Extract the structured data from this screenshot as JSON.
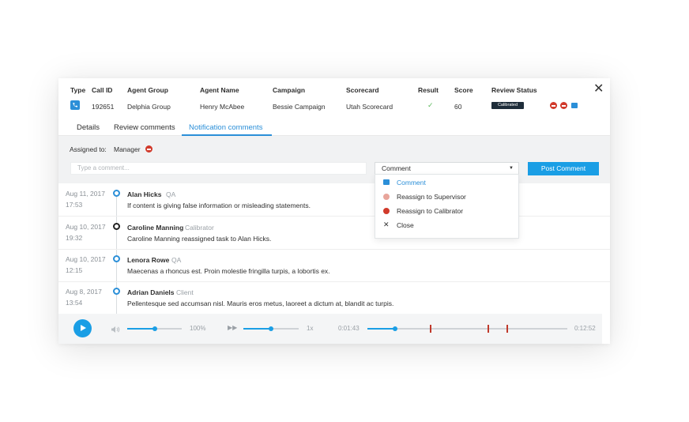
{
  "table": {
    "headers": [
      "Type",
      "Call ID",
      "Agent Group",
      "Agent Name",
      "Campaign",
      "Scorecard",
      "Result",
      "Score",
      "Review Status"
    ],
    "row": {
      "type_icon": "phone-icon",
      "call_id": "192651",
      "agent_group": "Delphia Group",
      "agent_name": "Henry McAbee",
      "campaign": "Bessie Campaign",
      "scorecard": "Utah Scorecard",
      "result_icon": "check-icon",
      "score": "60",
      "review_status": "Calibrated",
      "status_badges": [
        "supervisor-badge",
        "qa-badge",
        "comment-badge"
      ]
    }
  },
  "close_icon": "close-icon",
  "tabs": [
    {
      "label": "Details",
      "active": false
    },
    {
      "label": "Review comments",
      "active": false
    },
    {
      "label": "Notification comments",
      "active": true
    }
  ],
  "assigned": {
    "label": "Assigned to:",
    "value": "Manager"
  },
  "comment_input": {
    "placeholder": "Type a comment..."
  },
  "comment_type": {
    "selected": "Comment"
  },
  "post_button": "Post Comment",
  "dropdown_options": [
    {
      "label": "Comment",
      "icon": "comment-icon",
      "color": "#2b8fd8",
      "highlighted": true
    },
    {
      "label": "Reassign to Supervisor",
      "icon": "supervisor-icon",
      "color": "#e8a59b",
      "highlighted": false
    },
    {
      "label": "Reassign to Calibrator",
      "icon": "calibrator-icon",
      "color": "#d13a2b",
      "highlighted": false
    },
    {
      "label": "Close",
      "icon": "close-icon",
      "color": "#333333",
      "highlighted": false
    }
  ],
  "comments": [
    {
      "date": "Aug 11, 2017",
      "time": "17:53",
      "name": "Alan Hicks",
      "role": "QA",
      "text": "If content is giving false information or misleading statements.",
      "dot": "blue"
    },
    {
      "date": "Aug 10, 2017",
      "time": "19:32",
      "name": "Caroline Manning",
      "role": "Calibrator",
      "text": "Caroline Manning reassigned task to Alan Hicks.",
      "dot": "dark"
    },
    {
      "date": "Aug 10, 2017",
      "time": "12:15",
      "name": "Lenora Rowe",
      "role": "QA",
      "text": "Maecenas a rhoncus est. Proin molestie fringilla turpis, a lobortis ex.",
      "dot": "blue"
    },
    {
      "date": "Aug 8, 2017",
      "time": "13:54",
      "name": "Adrian Daniels",
      "role": "Client",
      "text": "Pellentesque sed accumsan nisl. Mauris eros metus, laoreet a dictum at, blandit ac turpis.",
      "dot": "blue"
    }
  ],
  "player": {
    "volume_label": "100%",
    "volume_level": 0.5,
    "speed_label": "1x",
    "speed_level": 0.5,
    "current_time": "0:01:43",
    "total_time": "0:12:52",
    "progress": 0.14
  },
  "colors": {
    "accent": "#1a9ee5",
    "marker": "#c0392b",
    "badge": "#1e2d3a"
  }
}
